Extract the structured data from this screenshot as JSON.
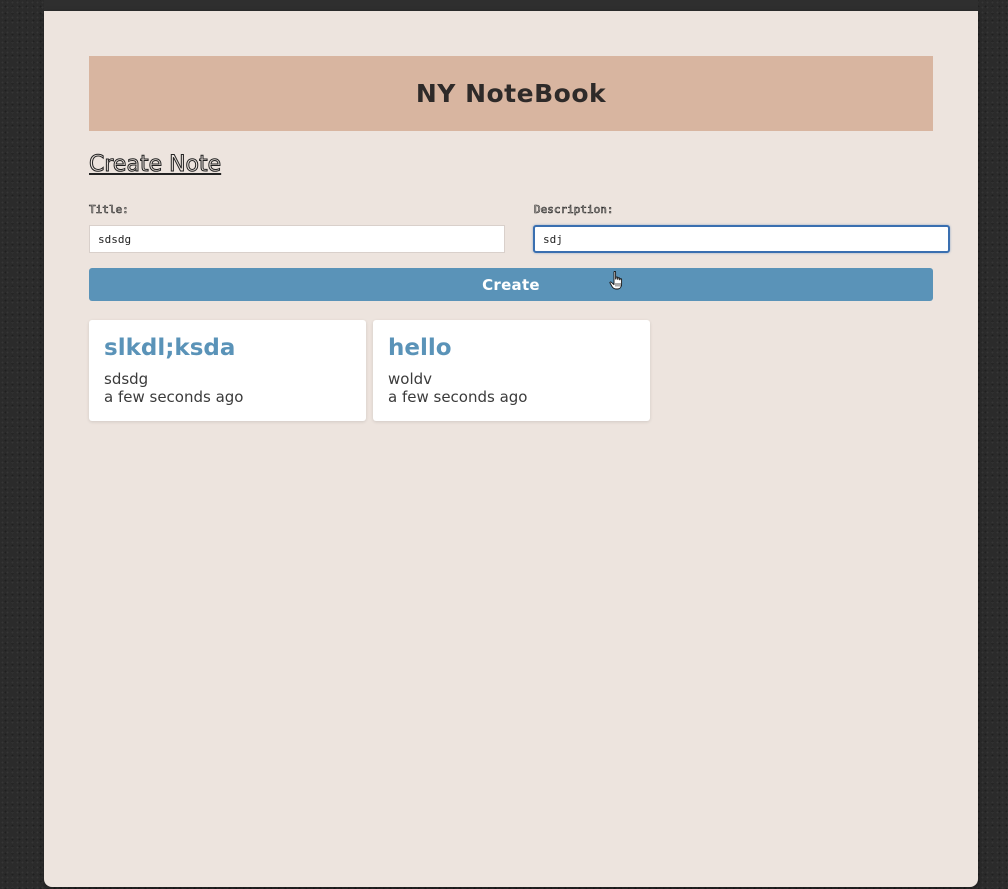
{
  "app": {
    "title": "NY NoteBook"
  },
  "form": {
    "section_title": "Create Note",
    "title_label": "Title:",
    "title_value": "sdsdg",
    "description_label": "Description:",
    "description_value": "sdj",
    "create_label": "Create"
  },
  "notes": [
    {
      "title": "slkdl;ksda",
      "description": "sdsdg",
      "time": "a few seconds ago"
    },
    {
      "title": "hello",
      "description": "woldv",
      "time": "a few seconds ago"
    }
  ],
  "colors": {
    "page_background": "#ede4de",
    "header_background": "#d8b5a0",
    "accent": "#5a93b8",
    "focus_border": "#3a6fb0"
  },
  "icons": {
    "cursor": "pointer-hand-icon"
  }
}
